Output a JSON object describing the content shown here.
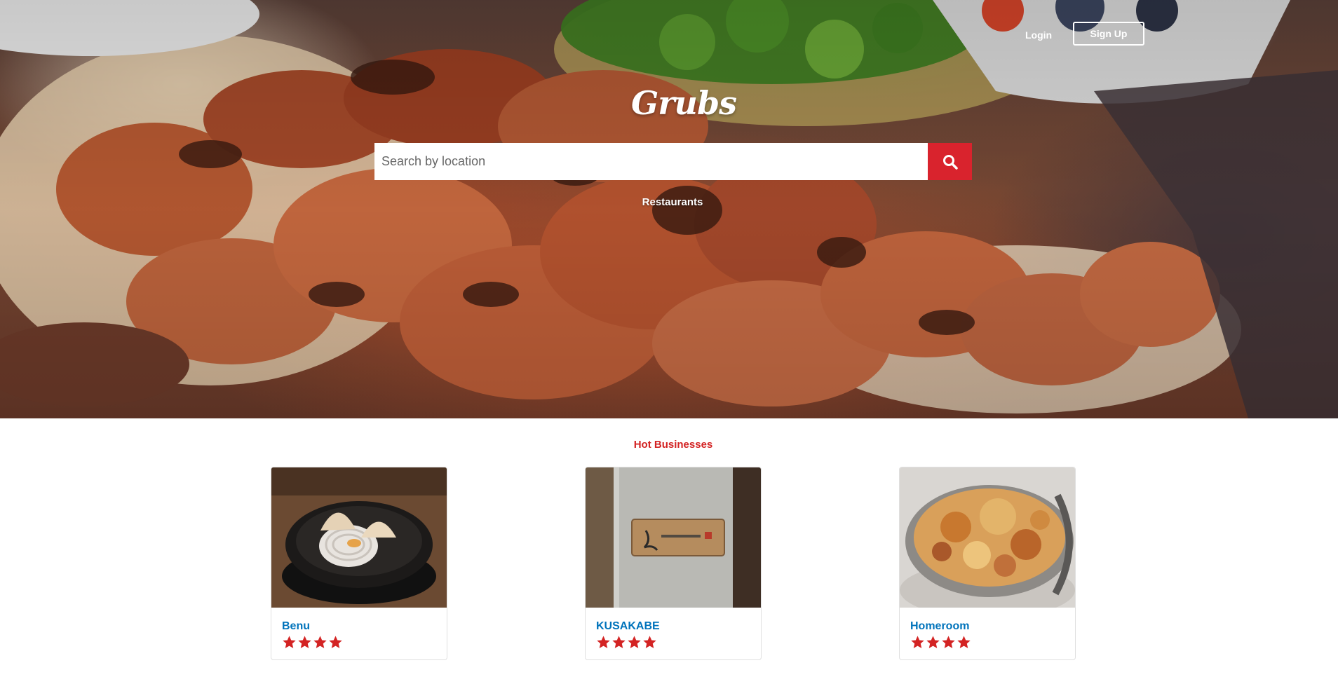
{
  "header": {
    "login_label": "Login",
    "signup_label": "Sign Up"
  },
  "hero": {
    "logo_text": "Grubs",
    "search": {
      "placeholder": "Search by location",
      "value": "",
      "button_icon": "search-icon"
    },
    "nav_link": "Restaurants"
  },
  "hot_businesses": {
    "title": "Hot Businesses",
    "items": [
      {
        "name": "Benu",
        "rating": 4,
        "photo": "dumplings-dish"
      },
      {
        "name": "KUSAKABE",
        "rating": 4,
        "photo": "wooden-sign-on-wall"
      },
      {
        "name": "Homeroom",
        "rating": 4,
        "photo": "mac-and-cheese"
      }
    ]
  },
  "colors": {
    "brand_red": "#d32323",
    "search_button": "#d9232d",
    "link_blue": "#0073bb",
    "star_red": "#d32323"
  }
}
